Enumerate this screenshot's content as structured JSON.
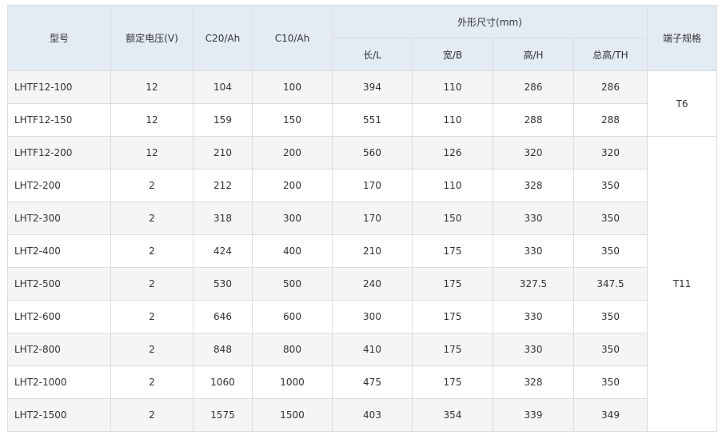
{
  "headers": {
    "model": "型号",
    "voltage": "额定电压(V)",
    "c20": "C20/Ah",
    "c10": "C10/Ah",
    "dimensions": "外形尺寸(mm)",
    "length": "长/L",
    "width": "宽/B",
    "height": "高/H",
    "total_height": "总高/TH",
    "terminal": "端子规格"
  },
  "rows": [
    {
      "model": "LHTF12-100",
      "voltage": "12",
      "c20": "104",
      "c10": "100",
      "length": "394",
      "width": "110",
      "height": "286",
      "total_height": "286"
    },
    {
      "model": "LHTF12-150",
      "voltage": "12",
      "c20": "159",
      "c10": "150",
      "length": "551",
      "width": "110",
      "height": "288",
      "total_height": "288"
    },
    {
      "model": "LHTF12-200",
      "voltage": "12",
      "c20": "210",
      "c10": "200",
      "length": "560",
      "width": "126",
      "height": "320",
      "total_height": "320"
    },
    {
      "model": "LHT2-200",
      "voltage": "2",
      "c20": "212",
      "c10": "200",
      "length": "170",
      "width": "110",
      "height": "328",
      "total_height": "350"
    },
    {
      "model": "LHT2-300",
      "voltage": "2",
      "c20": "318",
      "c10": "300",
      "length": "170",
      "width": "150",
      "height": "330",
      "total_height": "350"
    },
    {
      "model": "LHT2-400",
      "voltage": "2",
      "c20": "424",
      "c10": "400",
      "length": "210",
      "width": "175",
      "height": "330",
      "total_height": "350"
    },
    {
      "model": "LHT2-500",
      "voltage": "2",
      "c20": "530",
      "c10": "500",
      "length": "240",
      "width": "175",
      "height": "327.5",
      "total_height": "347.5"
    },
    {
      "model": "LHT2-600",
      "voltage": "2",
      "c20": "646",
      "c10": "600",
      "length": "300",
      "width": "175",
      "height": "330",
      "total_height": "350"
    },
    {
      "model": "LHT2-800",
      "voltage": "2",
      "c20": "848",
      "c10": "800",
      "length": "410",
      "width": "175",
      "height": "330",
      "total_height": "350"
    },
    {
      "model": "LHT2-1000",
      "voltage": "2",
      "c20": "1060",
      "c10": "1000",
      "length": "475",
      "width": "175",
      "height": "328",
      "total_height": "350"
    },
    {
      "model": "LHT2-1500",
      "voltage": "2",
      "c20": "1575",
      "c10": "1500",
      "length": "403",
      "width": "354",
      "height": "339",
      "total_height": "349"
    }
  ],
  "terminal_groups": [
    {
      "label": "T6",
      "row_count": 2
    },
    {
      "label": "T11",
      "row_count": 9
    }
  ],
  "colors": {
    "header_bg": "#e3ebf4",
    "stripe_bg": "#f5f5f5",
    "border": "#dcdcdc",
    "text": "#333333"
  }
}
